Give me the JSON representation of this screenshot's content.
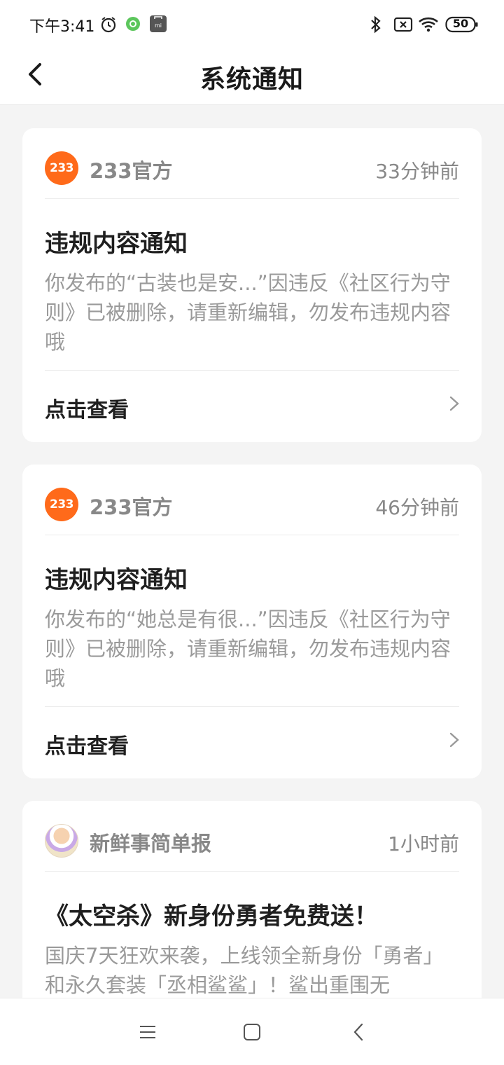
{
  "status_bar": {
    "time": "下午3:41",
    "battery": "50",
    "icons": [
      "alarm-icon",
      "app-notification-icon",
      "mi-store-icon",
      "bluetooth-icon",
      "sim-off-icon",
      "wifi-icon",
      "battery-icon"
    ]
  },
  "header": {
    "title": "系统通知",
    "back_icon": "chevron-left-icon"
  },
  "notifications": [
    {
      "sender": "233官方",
      "avatar_text": "233",
      "time": "33分钟前",
      "title": "违规内容通知",
      "body": "你发布的“古装也是安...”因违反《社区行为守则》已被删除，请重新编辑，勿发布违规内容哦",
      "action": "点击查看"
    },
    {
      "sender": "233官方",
      "avatar_text": "233",
      "time": "46分钟前",
      "title": "违规内容通知",
      "body": "你发布的“她总是有很...”因违反《社区行为守则》已被删除，请重新编辑，勿发布违规内容哦",
      "action": "点击查看"
    },
    {
      "sender": "新鲜事简单报",
      "time": "1小时前",
      "title": "《太空杀》新身份勇者免费送！",
      "body": "国庆7天狂欢来袭，上线领全新身份「勇者」和永久套装「丞相鲨鲨」！鲨出重围无"
    }
  ],
  "nav_bar": {
    "icons": [
      "menu-icon",
      "home-icon",
      "back-icon"
    ]
  },
  "colors": {
    "accent": "#ff6a1a",
    "background": "#f4f4f4",
    "card": "#ffffff",
    "title_text": "#1f1f1f",
    "secondary_text": "#9a9a9a"
  }
}
